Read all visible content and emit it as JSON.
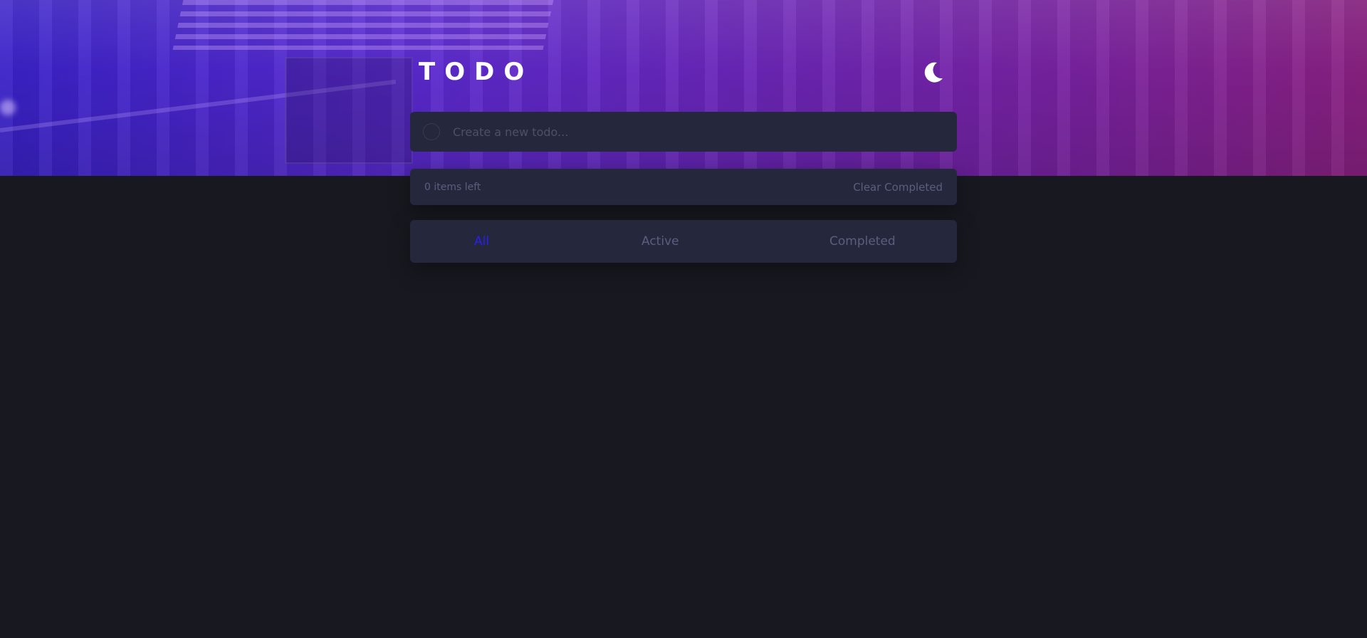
{
  "app": {
    "title": "TODO",
    "theme_icon": "moon-icon"
  },
  "new_todo": {
    "placeholder": "Create a new todo..."
  },
  "summary": {
    "items_left": "0 items left",
    "clear_label": "Clear Completed"
  },
  "filters": {
    "all": "All",
    "active": "Active",
    "completed": "Completed",
    "selected": "All"
  },
  "colors": {
    "background": "#181920",
    "card": "#25273c",
    "muted_text": "#5b5e7e",
    "active_filter": "#2a1ff0",
    "hero_gradient_start": "#3a22c8",
    "hero_gradient_end": "#8a2182"
  }
}
